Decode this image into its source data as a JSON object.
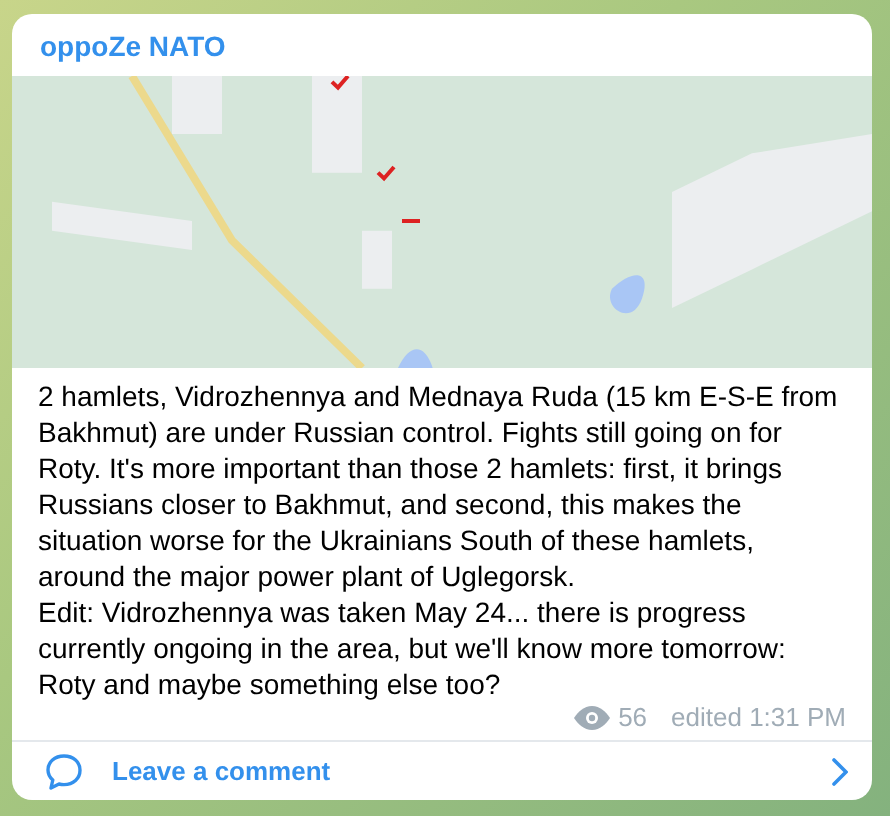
{
  "channel": {
    "title": "oppoZe NATO"
  },
  "post": {
    "text": "2 hamlets, Vidrozhennya and Mednaya Ruda (15 km E-S-E from Bakhmut) are under Russian control. Fights still going on for Roty. It's more important than those 2 hamlets: first, it brings Russians closer to Bakhmut, and second, this makes the situation worse for the Ukrainians South of these hamlets, around the major power plant of Uglegorsk.\nEdit: Vidrozhennya was taken May 24... there is progress currently ongoing in the area, but we'll know more tomorrow: Roty and maybe something else too?",
    "views": "56",
    "edited": "edited 1:31 PM"
  },
  "comment_link": {
    "label": "Leave a comment"
  }
}
